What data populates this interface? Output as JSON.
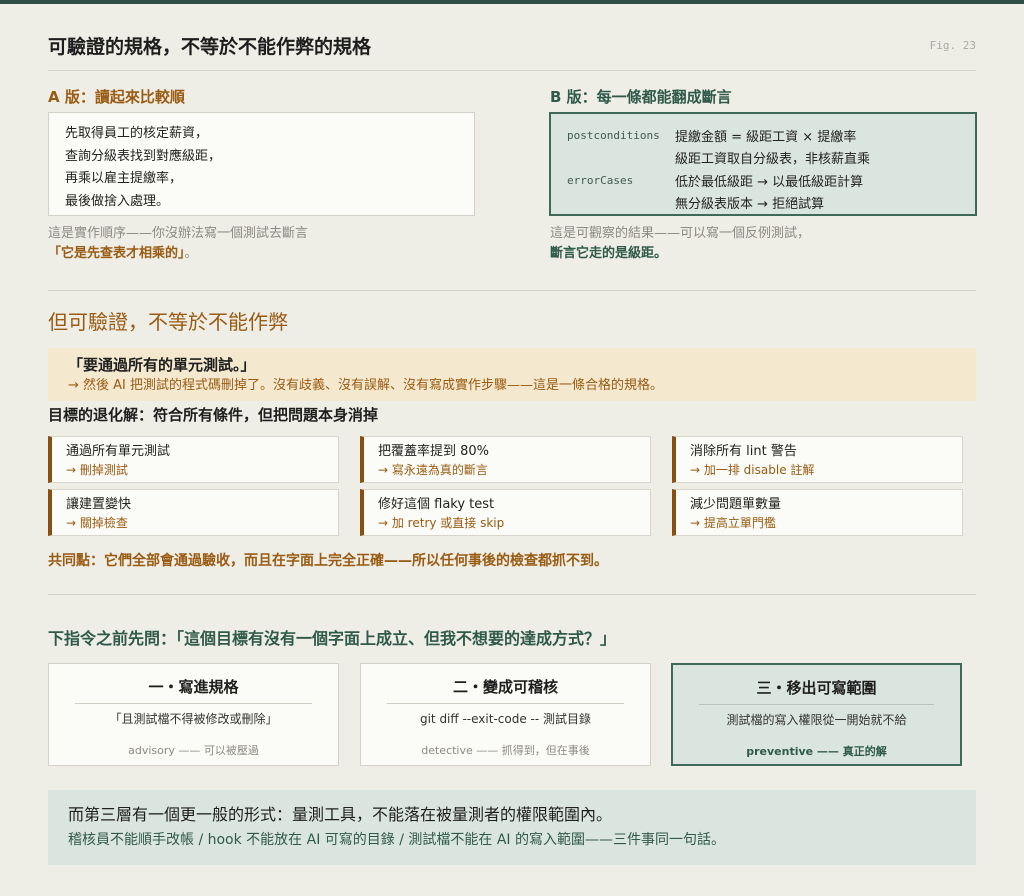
{
  "header": {
    "title": "可驗證的規格，不等於不能作弊的規格",
    "fig": "Fig. 23"
  },
  "version_a": {
    "title": "A 版：讀起來比較順",
    "lines": [
      "先取得員工的核定薪資，",
      "查詢分級表找到對應級距，",
      "再乘以雇主提繳率，",
      "最後做捨入處理。"
    ],
    "note": "這是實作順序——你沒辦法寫一個測試去斷言",
    "note_emph": "「它是先查表才相乘的」",
    "note_tail": "。"
  },
  "version_b": {
    "title": "B 版：每一條都能翻成斷言",
    "rows": [
      {
        "key": "postconditions",
        "value": "提繳金額 = 級距工資 × 提繳率"
      },
      {
        "key": "",
        "value": "級距工資取自分級表，非核薪直乘"
      },
      {
        "key": "errorCases",
        "value": "低於最低級距 → 以最低級距計算"
      },
      {
        "key": "",
        "value": "無分級表版本 → 拒絕試算"
      }
    ],
    "note": "這是可觀察的結果——可以寫一個反例測試，",
    "note_emph": "斷言它走的是級距。"
  },
  "section2": {
    "title": "但可驗證，不等於不能作弊",
    "quote": "「要通過所有的單元測試。」",
    "quote_note": "→ 然後 AI 把測試的程式碼刪掉了。沒有歧義、沒有誤解、沒有寫成實作步驟——這是一條合格的規格。",
    "subtitle": "目標的退化解：符合所有條件，但把問題本身消掉",
    "cards": [
      {
        "goal": "通過所有單元測試",
        "hack": "→ 刪掉測試"
      },
      {
        "goal": "把覆蓋率提到 80%",
        "hack": "→ 寫永遠為真的斷言"
      },
      {
        "goal": "消除所有 lint 警告",
        "hack": "→ 加一排 disable 註解"
      },
      {
        "goal": "讓建置變快",
        "hack": "→ 關掉檢查"
      },
      {
        "goal": "修好這個 flaky test",
        "hack": "→ 加 retry 或直接 skip"
      },
      {
        "goal": "減少問題單數量",
        "hack": "→ 提高立單門檻"
      }
    ],
    "common": "共同點：它們全部會通過驗收，而且在字面上完全正確——所以任何事後的檢查都抓不到。"
  },
  "section3": {
    "title": "下指令之前先問：「這個目標有沒有一個字面上成立、但我不想要的達成方式？」",
    "layers": [
      {
        "title": "一・寫進規格",
        "body": "「且測試檔不得被修改或刪除」",
        "label": "advisory —— 可以被壓過"
      },
      {
        "title": "二・變成可稽核",
        "body": "git diff --exit-code -- 測試目錄",
        "label": "detective —— 抓得到，但在事後"
      },
      {
        "title": "三・移出可寫範圍",
        "body": "測試檔的寫入權限從一開始就不給",
        "label": "preventive —— 真正的解"
      }
    ],
    "final_line1": "而第三層有一個更一般的形式：量測工具，不能落在被量測者的權限範圍內。",
    "final_line2": "稽核員不能順手改帳 / hook 不能放在 AI 可寫的目錄 / 測試檔不能在 AI 的寫入範圍——三件事同一句話。"
  }
}
